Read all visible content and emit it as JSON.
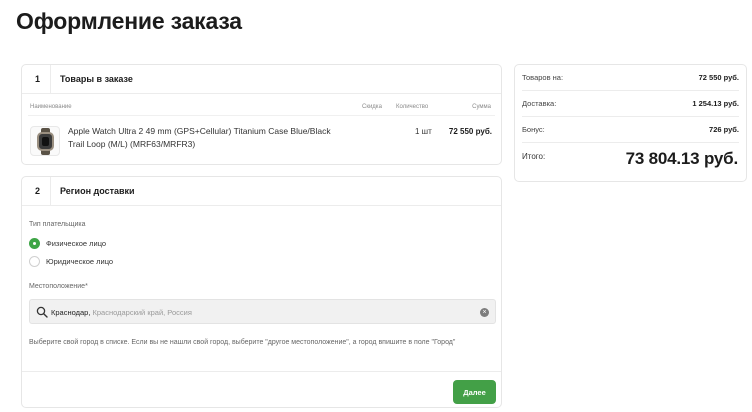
{
  "page": {
    "title": "Оформление заказа"
  },
  "items_section": {
    "number": "1",
    "title": "Товары в заказе",
    "columns": {
      "name": "Наименование",
      "discount": "Скидка",
      "quantity": "Количество",
      "sum": "Сумма"
    },
    "items": [
      {
        "name": "Apple Watch Ultra 2 49 mm (GPS+Cellular) Titanium Case Blue/Black Trail Loop (M/L) (MRF63/MRFR3)",
        "quantity": "1 шт",
        "sum": "72 550 руб."
      }
    ]
  },
  "delivery_section": {
    "number": "2",
    "title": "Регион доставки",
    "payer_type_label": "Тип плательщика",
    "payer_options": [
      {
        "label": "Физическое лицо",
        "selected": true
      },
      {
        "label": "Юридическое лицо",
        "selected": false
      }
    ],
    "location_label": "Местоположение*",
    "location_value_main": "Краснодар,",
    "location_value_rest": " Краснодарский край, Россия",
    "hint": "Выберите свой город в списке. Если вы не нашли свой город, выберите \"другое местоположение\", а город впишите в поле \"Город\"",
    "next_button": "Далее"
  },
  "summary": {
    "rows": [
      {
        "label": "Товаров на:",
        "value": "72 550 руб."
      },
      {
        "label": "Доставка:",
        "value": "1 254.13 руб."
      },
      {
        "label": "Бонус:",
        "value": "726 руб."
      }
    ],
    "total_label": "Итого:",
    "total_value": "73 804.13 руб."
  },
  "colors": {
    "accent": "#43a047",
    "radio_selected": "#3ea546"
  },
  "icons": {
    "search": "search-icon",
    "clear": "clear-icon"
  }
}
